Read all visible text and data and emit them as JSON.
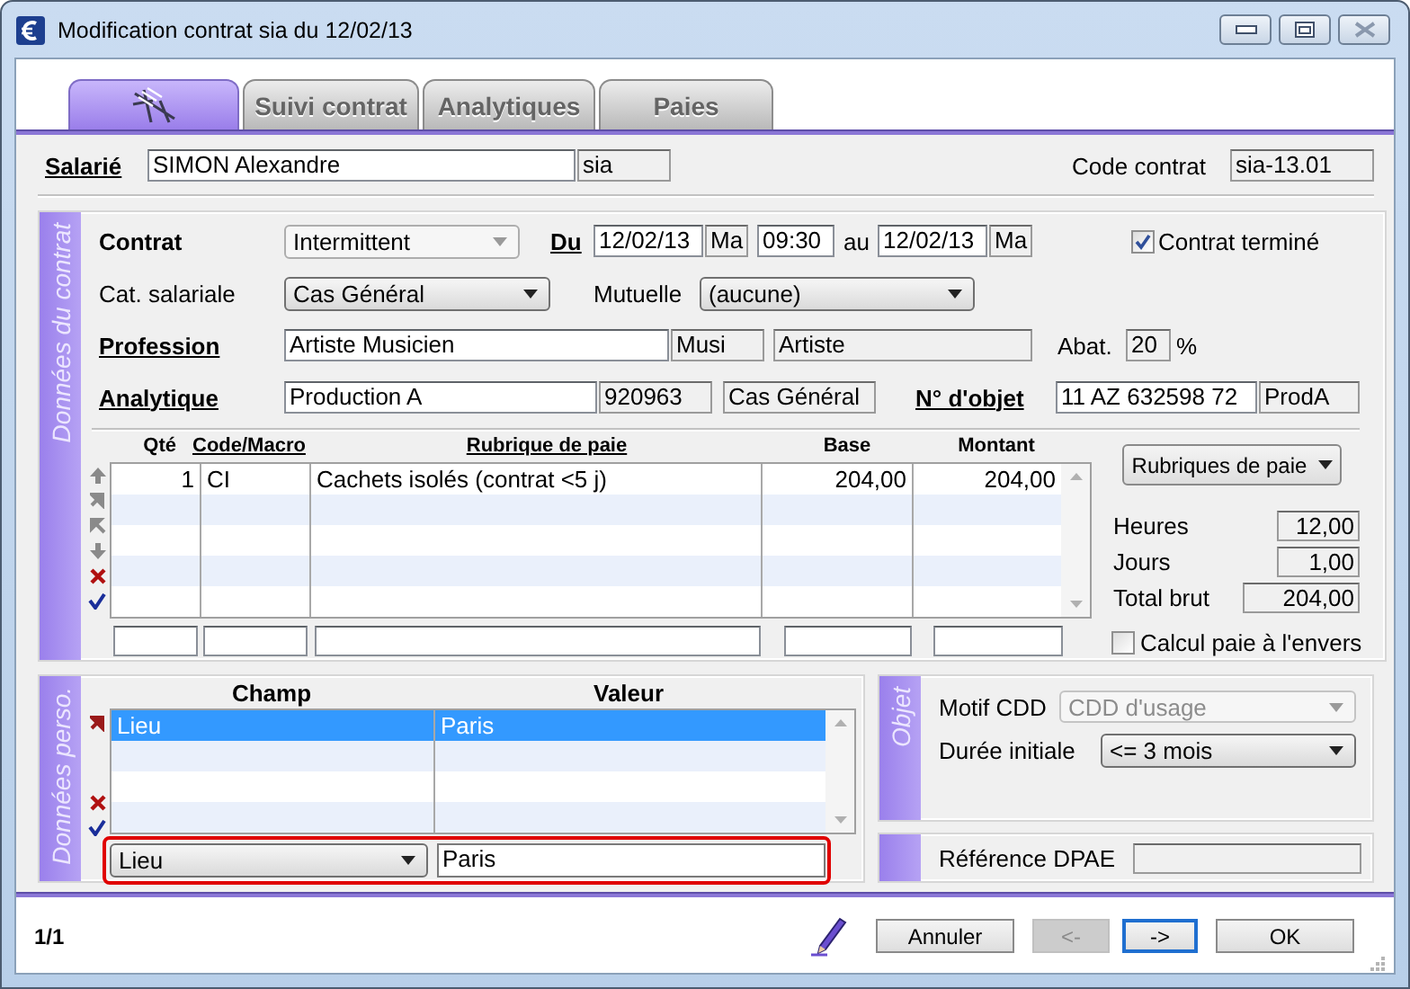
{
  "window": {
    "title": "Modification contrat sia du 12/02/13"
  },
  "tabs": [
    {
      "kind": "icon",
      "selected": true
    },
    {
      "kind": "text",
      "label": "Suivi contrat",
      "selected": false
    },
    {
      "kind": "text",
      "label": "Analytiques",
      "selected": false
    },
    {
      "kind": "text",
      "label": "Paies",
      "selected": false
    }
  ],
  "header": {
    "salarie": {
      "label": {
        "text": "Salarié",
        "kind": "link"
      },
      "name": "SIMON Alexandre",
      "code": "sia"
    },
    "code_contrat": {
      "label": "Code contrat",
      "value": "sia-13.01"
    }
  },
  "contract": {
    "title": "Données du contrat",
    "contrat": {
      "label": {
        "text": "Contrat",
        "kind": "bold"
      },
      "value": "Intermittent"
    },
    "du": {
      "label": {
        "text": "Du",
        "kind": "link"
      },
      "date": "12/02/13",
      "day": "Ma",
      "time": "09:30"
    },
    "au": {
      "label": "au",
      "date": "12/02/13",
      "day": "Ma"
    },
    "termine": {
      "label": "Contrat terminé",
      "checked": true
    },
    "categorie": {
      "label": {
        "text": "Cat. salariale",
        "kind": "plain"
      },
      "value": "Cas Général"
    },
    "mutuelle": {
      "label": "Mutuelle",
      "value": "(aucune)"
    },
    "profession": {
      "label": {
        "text": "Profession",
        "kind": "link"
      },
      "value": "Artiste Musicien",
      "code": "Musi",
      "category": "Artiste"
    },
    "abattement": {
      "label": "Abat.",
      "value": "20",
      "unit": "%"
    },
    "analytique": {
      "label": {
        "text": "Analytique",
        "kind": "link"
      },
      "value": "Production A",
      "code": "920963",
      "category": "Cas Général"
    },
    "objet": {
      "label": {
        "text": "N° d'objet",
        "kind": "link"
      },
      "value": "11 AZ 632598 72",
      "code": "ProdA"
    },
    "lines": {
      "columns": [
        {
          "label": "Qté",
          "kind": "plain"
        },
        {
          "label": "Code/Macro",
          "kind": "link"
        },
        {
          "label": "Rubrique de paie",
          "kind": "link"
        },
        {
          "label": "Base",
          "kind": "plain"
        },
        {
          "label": "Montant",
          "kind": "plain"
        }
      ],
      "rows": [
        [
          "1",
          "CI",
          "Cachets isolés (contrat <5 j)",
          "204,00",
          "204,00"
        ]
      ]
    },
    "rubriques_button": "Rubriques de paie",
    "totals": [
      {
        "label": "Heures",
        "value": "12,00"
      },
      {
        "label": "Jours",
        "value": "1,00"
      },
      {
        "label": "Total brut",
        "value": "204,00"
      }
    ],
    "calcul_envers": {
      "label": "Calcul paie à l'envers",
      "checked": false
    }
  },
  "perso": {
    "title": "Données perso.",
    "columns": [
      "Champ",
      "Valeur"
    ],
    "rows": [
      {
        "champ": "Lieu",
        "valeur": "Paris",
        "selected": true
      }
    ],
    "editor": {
      "champ": "Lieu",
      "valeur": "Paris",
      "highlighted": true
    }
  },
  "objet_panel": {
    "title": "Objet",
    "motif": {
      "label": "Motif CDD",
      "value": "CDD d'usage",
      "disabled": true
    },
    "duree": {
      "label": "Durée initiale",
      "value": "<= 3 mois",
      "disabled": false
    }
  },
  "dpae": {
    "label": "Référence DPAE"
  },
  "footer": {
    "page": "1/1",
    "buttons": [
      {
        "label": "Annuler",
        "disabled": false,
        "focused": false
      },
      {
        "label": "<-",
        "disabled": true,
        "focused": false
      },
      {
        "label": "->",
        "disabled": false,
        "focused": true
      },
      {
        "label": "OK",
        "disabled": false,
        "focused": false
      }
    ]
  }
}
